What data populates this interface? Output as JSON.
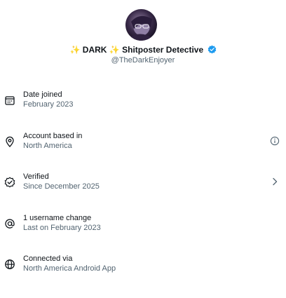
{
  "profile": {
    "display_name_prefix_emoji": "✨",
    "display_name_main": "DARK",
    "display_name_mid_emoji": "✨",
    "display_name_suffix": "Shitposter Detective",
    "handle": "@TheDarkEnjoyer",
    "verified_badge_color": "#1d9bf0"
  },
  "details": [
    {
      "icon": "calendar-icon",
      "title": "Date joined",
      "value": "February 2023"
    },
    {
      "icon": "location-pin-icon",
      "title": "Account based in",
      "value": "North America",
      "trailing_icon": "info-icon"
    },
    {
      "icon": "verified-check-icon",
      "title": "Verified",
      "value": "Since December 2025",
      "trailing_icon": "chevron-right-icon"
    },
    {
      "icon": "at-sign-icon",
      "title": "1 username change",
      "value": "Last on February 2023"
    },
    {
      "icon": "globe-icon",
      "title": "Connected via",
      "value": "North America Android App"
    }
  ]
}
